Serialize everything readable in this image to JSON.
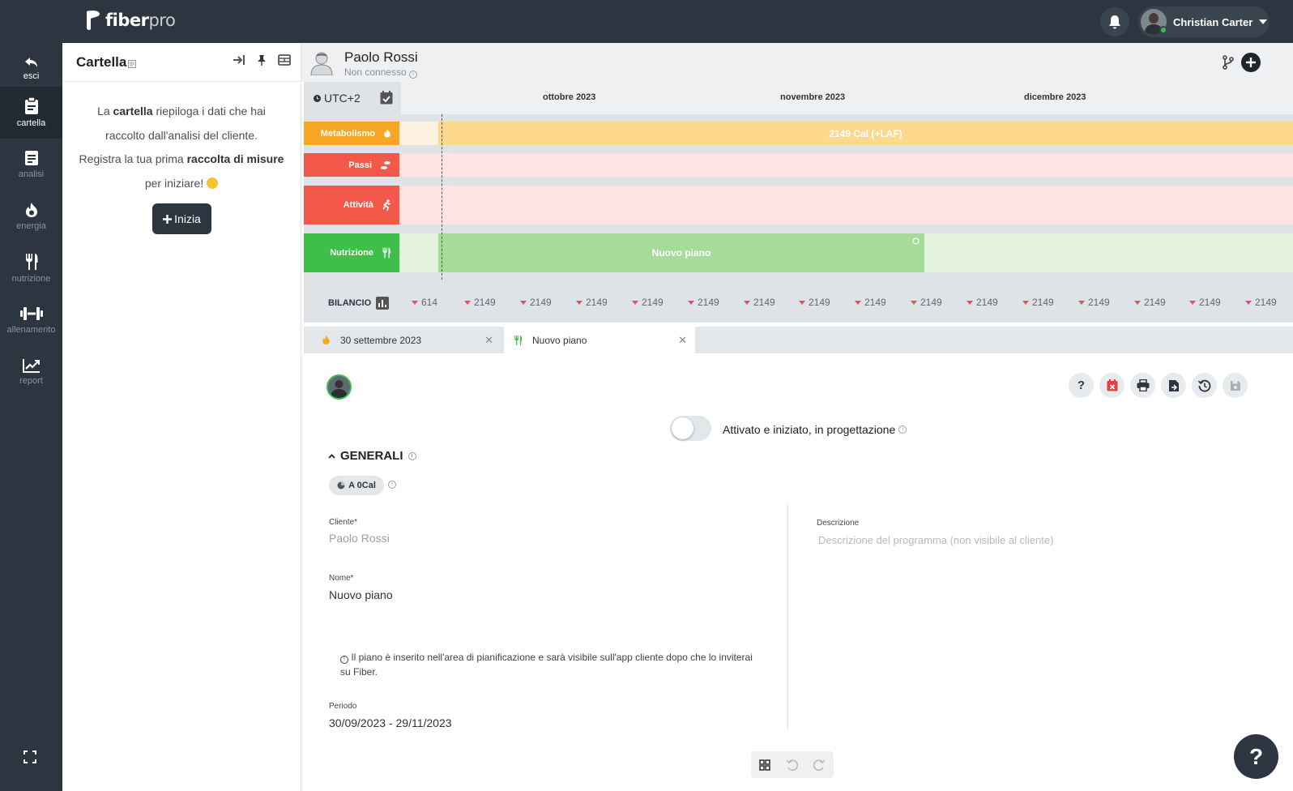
{
  "app": {
    "logo": {
      "brand": "fiber",
      "suffix": "pro"
    },
    "user": {
      "name": "Christian Carter"
    }
  },
  "nav": {
    "exit": "esci",
    "items": [
      {
        "key": "cartella",
        "label": "cartella",
        "icon": "clipboard-icon"
      },
      {
        "key": "analisi",
        "label": "analisi",
        "icon": "document-icon"
      },
      {
        "key": "energia",
        "label": "energia",
        "icon": "flame-icon"
      },
      {
        "key": "nutrizione",
        "label": "nutrizione",
        "icon": "cutlery-icon"
      },
      {
        "key": "allenamento",
        "label": "allenamento",
        "icon": "dumbbell-icon"
      },
      {
        "key": "report",
        "label": "report",
        "icon": "chart-line-icon"
      }
    ]
  },
  "cartella": {
    "title": "Cartella",
    "text_1_a": "La ",
    "text_1_b": "cartella",
    "text_1_c": " riepiloga i dati che hai raccolto dall'analisi del cliente.",
    "text_2_a": "Registra la tua prima ",
    "text_2_b": "raccolta di misure",
    "text_2_c": " per iniziare! ",
    "button": "Inizia"
  },
  "client": {
    "name": "Paolo Rossi",
    "status": "Non connesso"
  },
  "timeline": {
    "timezone": "UTC+2",
    "months": [
      "ottobre 2023",
      "novembre 2023",
      "dicembre 2023"
    ],
    "rows": {
      "metabolismo": "Metabolismo",
      "passi": "Passi",
      "attivita": "Attività",
      "nutrizione": "Nutrizione"
    },
    "metabolismo_bar": "2149 Cal (+LAF)",
    "nutrizione_bar": "Nuovo piano",
    "colors": {
      "metabolismo": "#f6a623",
      "metabolismo_bg": "#fdd88d",
      "passi": "#f3594a",
      "attivita": "#f3594a",
      "row_light_bg": "#fde4e0",
      "nutrizione": "#3fbf4a",
      "nutrizione_bg": "#a6dc9a",
      "nutrizione_light_bg": "#e3f3df"
    }
  },
  "bilancio": {
    "label": "BILANCIO",
    "values": [
      "614",
      "2149",
      "2149",
      "2149",
      "2149",
      "2149",
      "2149",
      "2149",
      "2149",
      "2149",
      "2149",
      "2149",
      "2149",
      "2149",
      "2149",
      "2149"
    ]
  },
  "tabs": [
    {
      "label": "30 settembre 2023",
      "icon": "flame-icon"
    },
    {
      "label": "Nuovo piano",
      "icon": "cutlery-icon"
    }
  ],
  "plan": {
    "toggle_label": "Attivato e iniziato, in progettazione",
    "section": "GENERALI",
    "chip": "A 0Cal",
    "fields": {
      "cliente_label": "Cliente*",
      "cliente_value": "Paolo Rossi",
      "descrizione_label": "Descrizione",
      "descrizione_placeholder": "Descrizione del programma (non visibile al cliente)",
      "nome_label": "Nome*",
      "nome_value": "Nuovo piano",
      "periodo_label": "Periodo",
      "periodo_value": "30/09/2023 - 29/11/2023"
    },
    "note": "Il piano è inserito nell'area di pianificazione e sarà visibile sull'app cliente dopo che lo inviterai su Fiber."
  }
}
